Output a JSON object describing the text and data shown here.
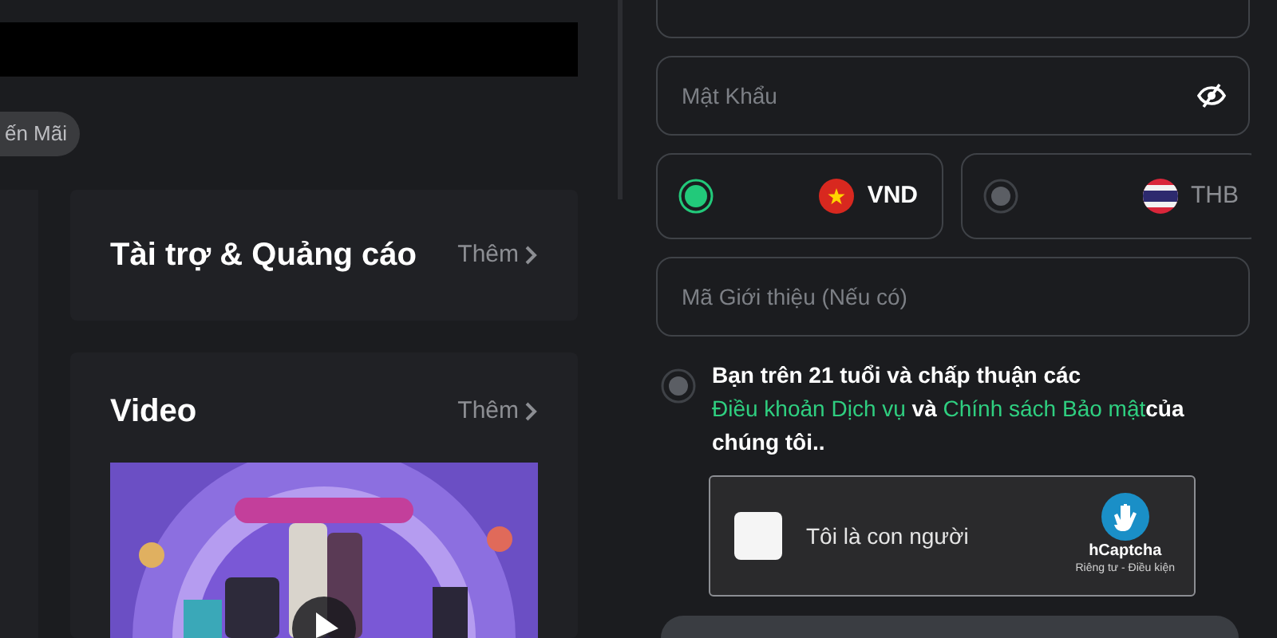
{
  "promo_chip": {
    "label": "ến Mãi"
  },
  "cards": [
    {
      "kind": "plain",
      "title": "Tài trợ & Quảng cáo",
      "more": "Thêm"
    },
    {
      "kind": "video",
      "title": "Video",
      "more": "Thêm"
    }
  ],
  "form": {
    "password": {
      "placeholder": "Mật Khẩu"
    },
    "currencies": [
      {
        "code": "VND",
        "kind": "vn",
        "selected": true
      },
      {
        "code": "THB",
        "kind": "th",
        "selected": false
      }
    ],
    "referral": {
      "placeholder": "Mã Giới thiệu (Nếu có)"
    },
    "agreement": {
      "checked": false,
      "parts": [
        {
          "text": "Bạn trên 21 tuổi và chấp thuận các ",
          "link": false
        },
        {
          "text": "Điều khoản Dịch vụ",
          "link": true
        },
        {
          "text": " và ",
          "link": false
        },
        {
          "text": "Chính sách Bảo mật",
          "link": true
        },
        {
          "text": "của chúng tôi..",
          "link": false
        }
      ]
    },
    "captcha": {
      "checked": false,
      "label": "Tôi là con người",
      "brand": "hCaptcha",
      "links": "Riêng tư - Điều kiện"
    }
  }
}
